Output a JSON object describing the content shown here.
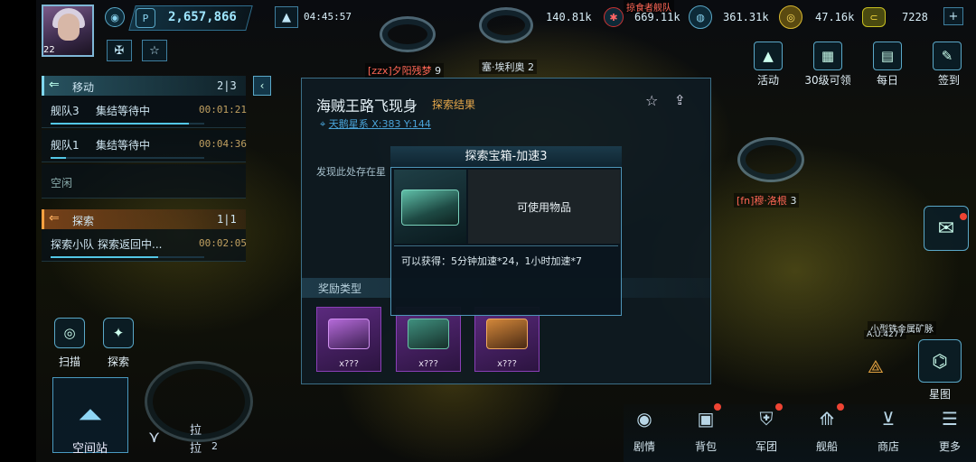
{
  "player": {
    "level": "22",
    "power": "2,657,866",
    "time": "04:45:57"
  },
  "top_resources": [
    {
      "icon": "planet-icon",
      "value": "361.31k"
    },
    {
      "icon": "coin-icon",
      "value": "47.16k"
    },
    {
      "icon": "credit-icon",
      "value": "7228"
    }
  ],
  "top_partial": {
    "v1": "140.81k",
    "v2": "669.11k"
  },
  "left_panel": {
    "move_title": "移动",
    "move_count": "2|3",
    "move_rows": [
      {
        "name": "舰队3",
        "status": "集结等待中",
        "timer": "00:01:21",
        "progress": 0.9
      },
      {
        "name": "舰队1",
        "status": "集结等待中",
        "timer": "00:04:36",
        "progress": 0.1
      }
    ],
    "idle": "空闲",
    "explore_title": "探索",
    "explore_count": "1|1",
    "explore_row": {
      "name": "探索小队",
      "status": "探索返回中...",
      "timer": "00:02:05",
      "progress": 0.7
    }
  },
  "left_buttons": {
    "scan": "扫描",
    "explore": "探索",
    "station": "空间站"
  },
  "dialog": {
    "title": "海贼王路飞现身",
    "subtitle": "探索结果",
    "location": "天鹅星系 X:383 Y:144",
    "body": "发现此处存在星",
    "reward_label": "奖励类型",
    "items": [
      {
        "qty": "x???"
      },
      {
        "qty": "x???"
      },
      {
        "qty": "x???"
      }
    ]
  },
  "popup": {
    "title": "探索宝箱-加速3",
    "desc": "可使用物品",
    "gain": "可以获得：5分钟加速*24，1小时加速*7"
  },
  "right_buttons": [
    {
      "label": "活动",
      "icon": "event-icon"
    },
    {
      "label": "30级可领",
      "icon": "gift-icon"
    },
    {
      "label": "每日",
      "icon": "daily-icon"
    },
    {
      "label": "签到",
      "icon": "checkin-icon"
    }
  ],
  "map_labels": {
    "l1": "[zzx]夕阳残梦",
    "l1n": "9",
    "l2": "塞·埃利奥",
    "l2n": "2",
    "l3": "[fn]穆·洛根",
    "l3n": "3",
    "l4": "掠食者舰队",
    "mine": "小型铁金属矿脉",
    "mine_code": "A.U.4277"
  },
  "star_map": "星图",
  "bottom_nav": [
    {
      "label": "剧情",
      "icon": "story-icon"
    },
    {
      "label": "背包",
      "icon": "backpack-icon"
    },
    {
      "label": "军团",
      "icon": "legion-icon"
    },
    {
      "label": "舰船",
      "icon": "ship-icon"
    },
    {
      "label": "商店",
      "icon": "shop-icon"
    },
    {
      "label": "更多",
      "icon": "more-icon"
    }
  ],
  "side_text": {
    "la": "拉",
    "lb": "拉",
    "n2": "2"
  }
}
